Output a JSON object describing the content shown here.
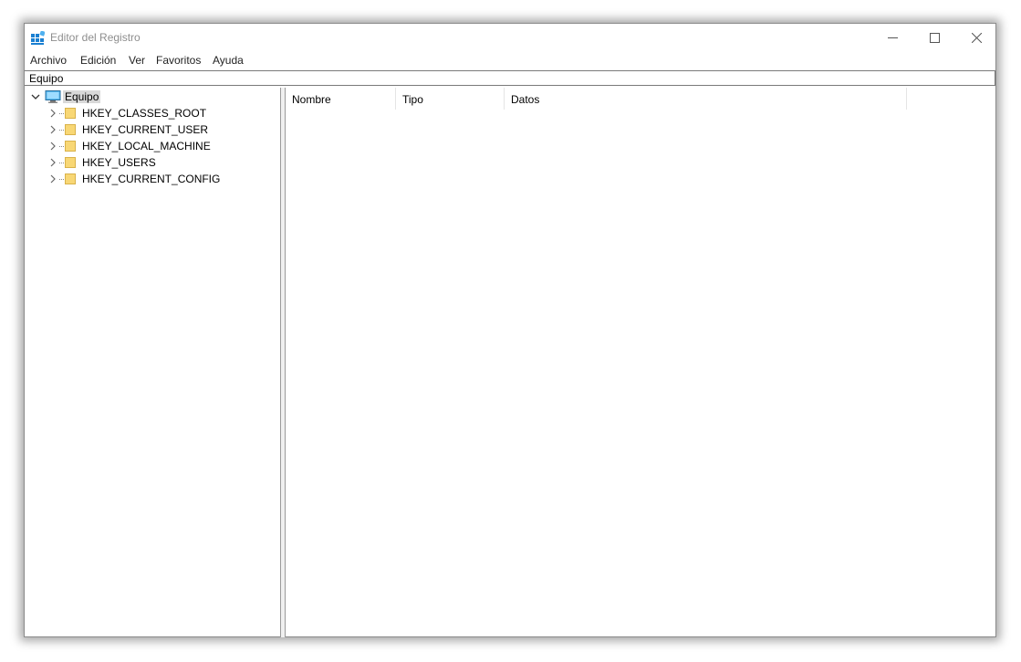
{
  "window": {
    "title": "Editor del Registro",
    "controls": [
      "minimize",
      "maximize",
      "close"
    ]
  },
  "menu": {
    "items": [
      "Archivo",
      "Edición",
      "Ver",
      "Favoritos",
      "Ayuda"
    ]
  },
  "address_bar": {
    "path": "Equipo"
  },
  "tree": {
    "root": {
      "label": "Equipo",
      "icon": "computer-icon",
      "expanded": true,
      "selected": true
    },
    "children": [
      {
        "label": "HKEY_CLASSES_ROOT",
        "icon": "folder-icon"
      },
      {
        "label": "HKEY_CURRENT_USER",
        "icon": "folder-icon"
      },
      {
        "label": "HKEY_LOCAL_MACHINE",
        "icon": "folder-icon"
      },
      {
        "label": "HKEY_USERS",
        "icon": "folder-icon"
      },
      {
        "label": "HKEY_CURRENT_CONFIG",
        "icon": "folder-icon"
      }
    ]
  },
  "values_pane": {
    "columns": [
      "Nombre",
      "Tipo",
      "Datos"
    ],
    "rows": []
  },
  "colors": {
    "folder": "#f8d775",
    "folder_border": "#d9b24a",
    "selection": "#d9d9d9",
    "title_text": "#8e8e8e"
  }
}
